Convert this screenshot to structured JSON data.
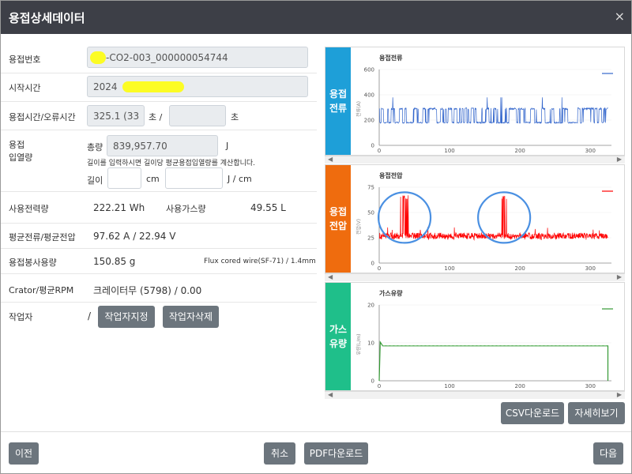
{
  "window": {
    "title": "용접상세데이터",
    "close_glyph": "×"
  },
  "fields": {
    "weld_no": {
      "label": "용접번호",
      "value": "-CO2-003_000000054744"
    },
    "start_time": {
      "label": "시작시간",
      "value": "2024"
    },
    "weld_time": {
      "label": "용접시간/오류시간",
      "value": "325.1 (33",
      "unit1": "초 /",
      "value2": "",
      "unit2": "초"
    },
    "heat_input": {
      "label_line1": "용접",
      "label_line2": "입열량",
      "total_label": "총량",
      "total_value": "839,957.70",
      "total_unit": "J",
      "hint": "길이를 입력하시면 길이당 평균용접입열량를 계산합니다.",
      "length_label": "길이",
      "length_value": "",
      "length_unit": "cm",
      "per_value": "",
      "per_unit": "J / cm"
    },
    "power": {
      "label": "사용전력량",
      "value": "222.21 Wh",
      "gas_label": "사용가스량",
      "gas_value": "49.55 L"
    },
    "avg": {
      "label": "평균전류/평균전압",
      "value": "97.62 A / 22.94 V"
    },
    "wire": {
      "label": "용접봉사용량",
      "value": "150.85 g",
      "type": "Flux cored wire(SF-71) / 1.4mm"
    },
    "crater": {
      "label": "Crator/평균RPM",
      "value": "크레이터무 (5798) / 0.00"
    },
    "worker": {
      "label": "작업자",
      "value": "/",
      "assign_btn": "작업자지정",
      "delete_btn": "작업자삭제"
    }
  },
  "colors": {
    "current": "#3366cc",
    "voltage": "#ff0000",
    "gas": "#339933",
    "side_current": "#1e9fd8",
    "side_voltage": "#ef6c0e",
    "side_gas": "#1fbf8a",
    "marker": "#4a90e2"
  },
  "panels": [
    {
      "side_label_1": "용접",
      "side_label_2": "전류",
      "title": "용접전류",
      "ylabel": "전류(A)"
    },
    {
      "side_label_1": "용접",
      "side_label_2": "전압",
      "title": "용접전압",
      "ylabel": "전압(V)"
    },
    {
      "side_label_1": "가스",
      "side_label_2": "유량",
      "title": "가스유량",
      "ylabel": "유량(L/m)"
    }
  ],
  "chart_data": [
    {
      "type": "line",
      "title": "용접전류",
      "xlim": [
        0,
        330
      ],
      "ylim": [
        0,
        600
      ],
      "yticks": [
        0,
        200,
        400,
        600
      ],
      "xticks": [
        0,
        100,
        200,
        300
      ],
      "series": [
        {
          "pattern": "pulsed",
          "high": 290,
          "low": 180,
          "peak": 380
        }
      ]
    },
    {
      "type": "line",
      "title": "용접전압",
      "xlim": [
        0,
        330
      ],
      "ylim": [
        0,
        75
      ],
      "yticks": [
        0,
        25,
        50,
        75
      ],
      "xticks": [
        0,
        100,
        200,
        300
      ],
      "series": [
        {
          "pattern": "noisy",
          "base": 27,
          "low": 23,
          "spikes": [
            {
              "x_start": 30,
              "x_end": 42,
              "peak": 67
            },
            {
              "x_start": 174,
              "x_end": 181,
              "peak": 67
            }
          ]
        }
      ]
    },
    {
      "type": "line",
      "title": "가스유량",
      "xlim": [
        0,
        330
      ],
      "ylim": [
        0,
        20
      ],
      "yticks": [
        0,
        10,
        20
      ],
      "xticks": [
        0,
        100,
        200,
        300
      ],
      "series": [
        {
          "pattern": "flat",
          "value": 9.2,
          "start_peak": 10.2
        }
      ]
    }
  ],
  "buttons": {
    "csv": "CSV다운로드",
    "detail": "자세히보기",
    "prev": "이전",
    "cancel": "취소",
    "pdf": "PDF다운로드",
    "next": "다음"
  }
}
